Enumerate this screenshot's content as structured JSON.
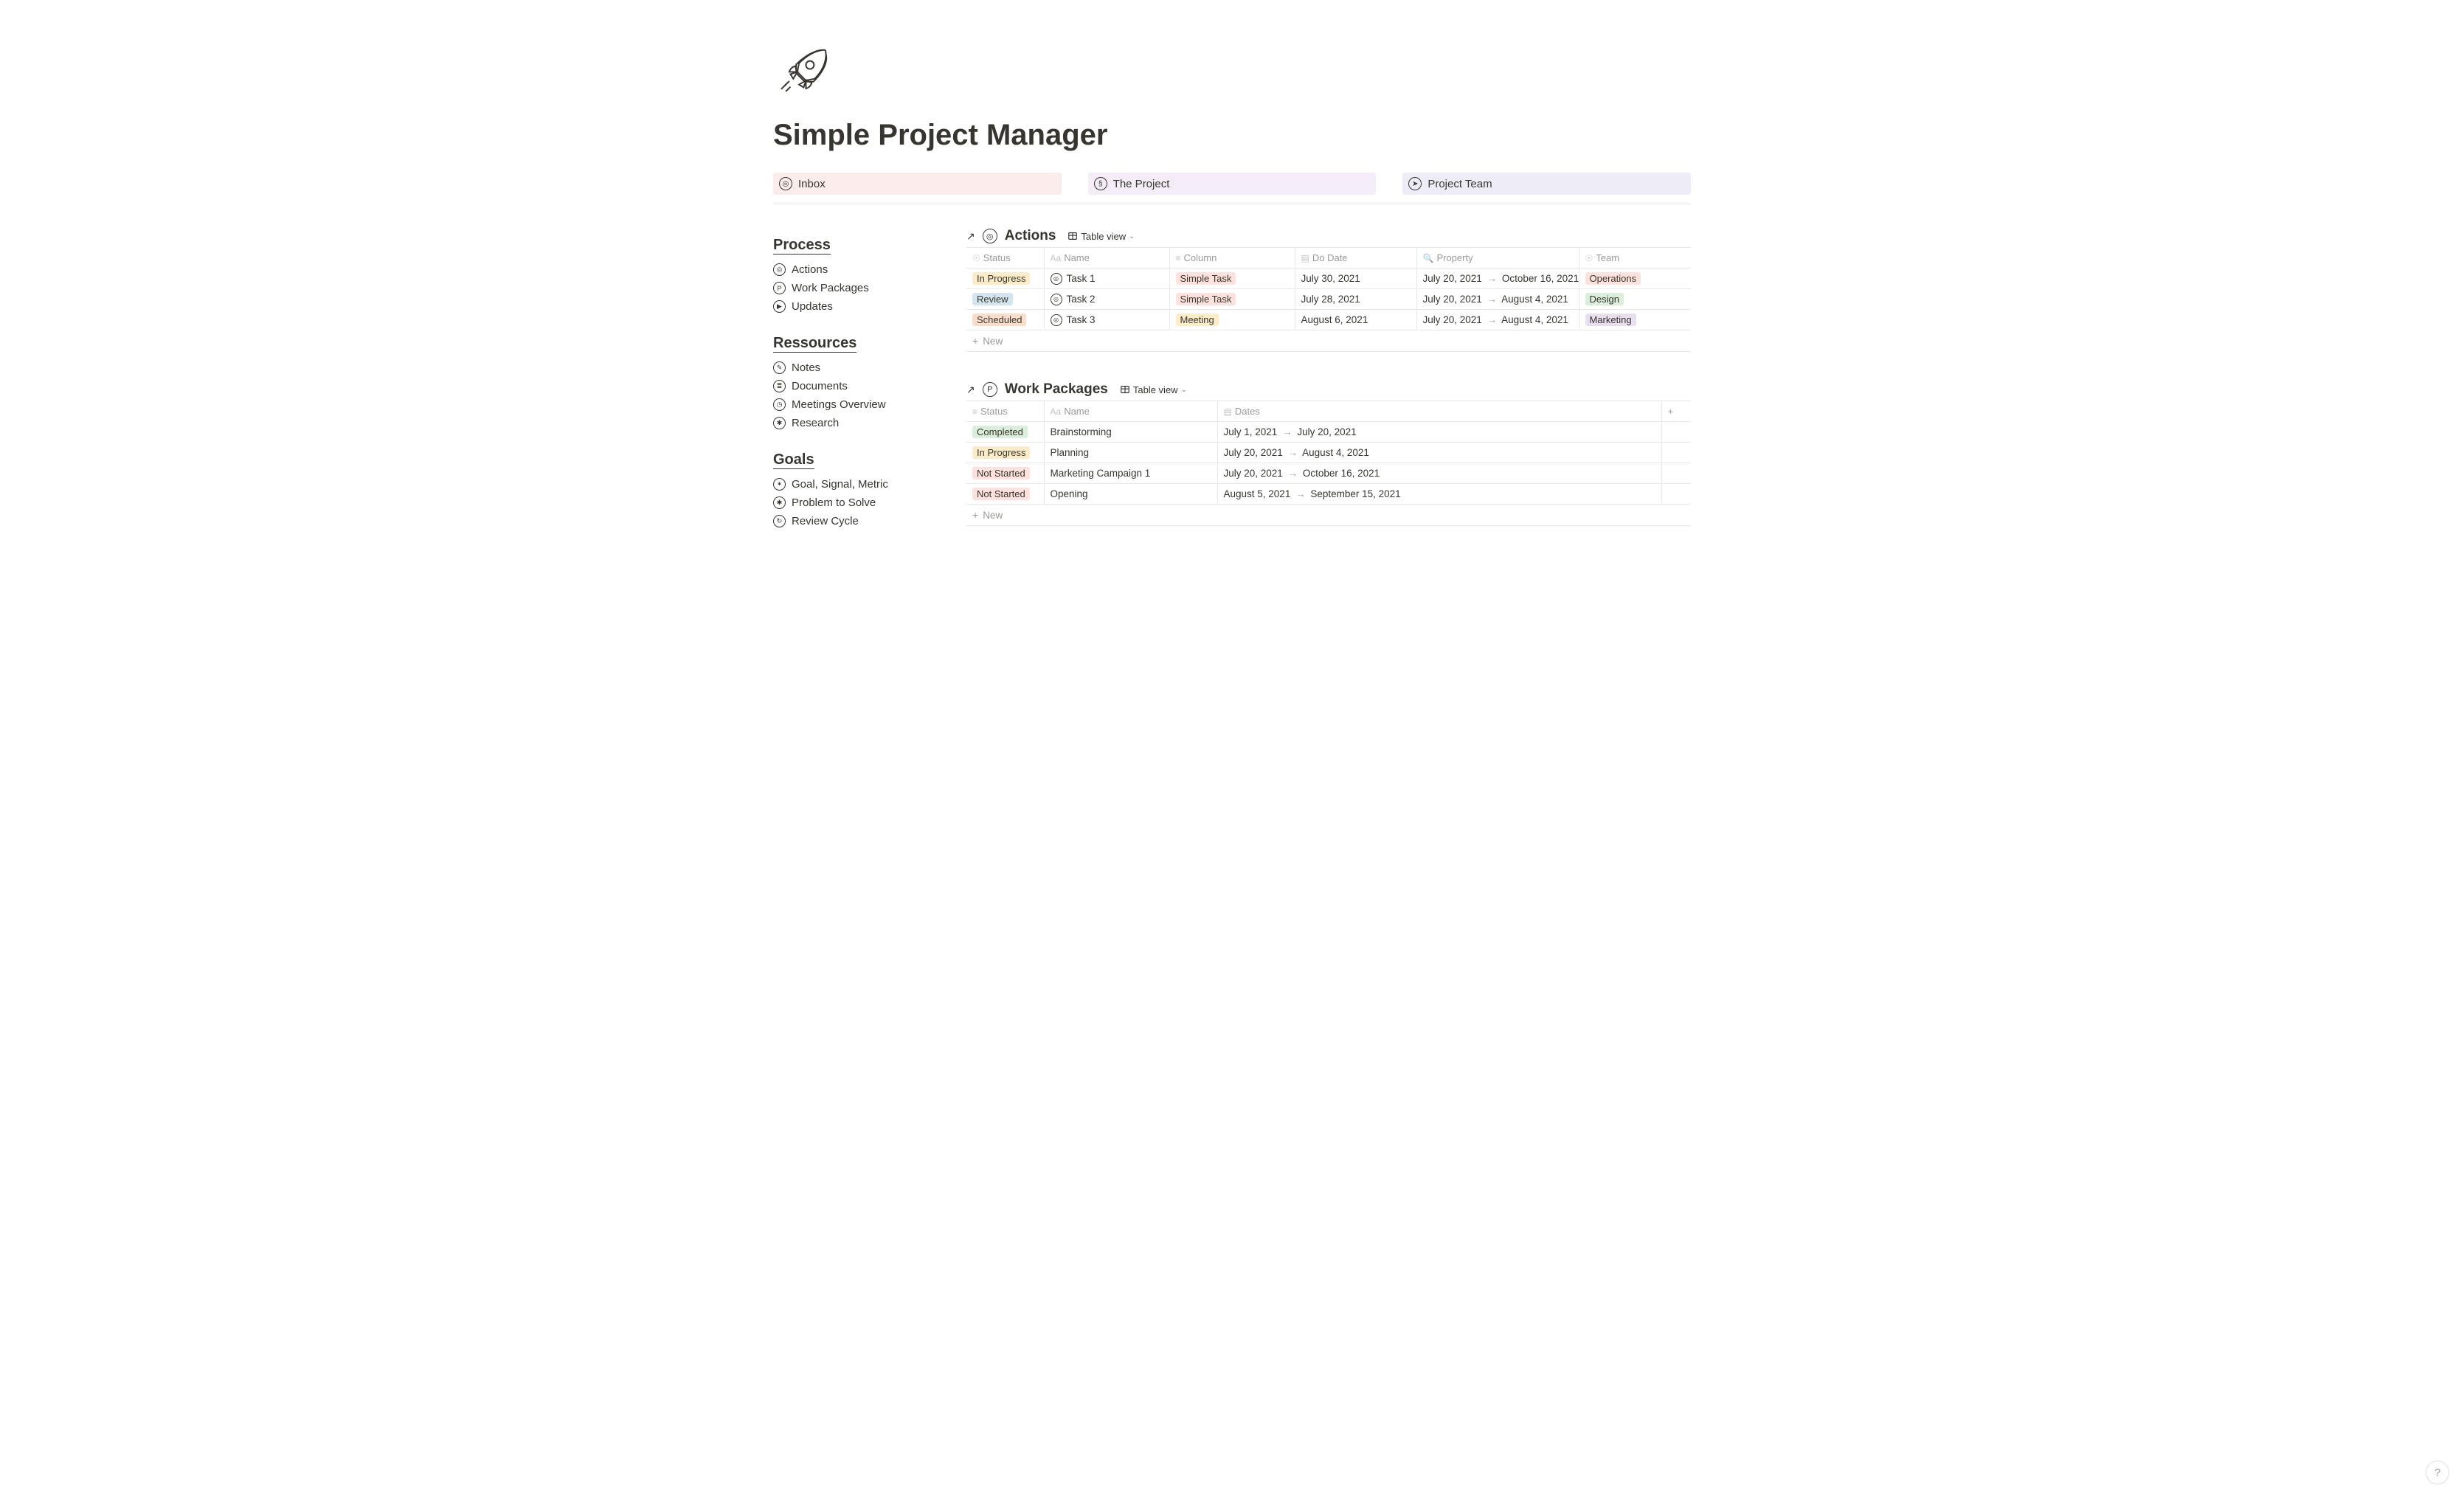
{
  "page": {
    "title": "Simple Project Manager"
  },
  "quick_links": [
    {
      "label": "Inbox"
    },
    {
      "label": "The Project"
    },
    {
      "label": "Project Team"
    }
  ],
  "sidebar": {
    "sections": [
      {
        "heading": "Process",
        "items": [
          {
            "label": "Actions"
          },
          {
            "label": "Work Packages"
          },
          {
            "label": "Updates"
          }
        ]
      },
      {
        "heading": "Ressources",
        "items": [
          {
            "label": "Notes"
          },
          {
            "label": "Documents"
          },
          {
            "label": "Meetings Overview"
          },
          {
            "label": "Research"
          }
        ]
      },
      {
        "heading": "Goals",
        "items": [
          {
            "label": "Goal, Signal, Metric"
          },
          {
            "label": "Problem to Solve"
          },
          {
            "label": "Review Cycle"
          }
        ]
      }
    ]
  },
  "db_actions": {
    "title": "Actions",
    "view_label": "Table view",
    "columns": [
      "Status",
      "Name",
      "Column",
      "Do Date",
      "Property",
      "Team"
    ],
    "rows": [
      {
        "status": "In Progress",
        "status_class": "inprogress",
        "name": "Task 1",
        "column": "Simple Task",
        "column_class": "simpletask",
        "do_date": "July 30, 2021",
        "property": "July 20, 2021 → October 16, 2021",
        "team": "Operations",
        "team_class": "operations"
      },
      {
        "status": "Review",
        "status_class": "review",
        "name": "Task 2",
        "column": "Simple Task",
        "column_class": "simpletask",
        "do_date": "July 28, 2021",
        "property": "July 20, 2021 → August 4, 2021",
        "team": "Design",
        "team_class": "design"
      },
      {
        "status": "Scheduled",
        "status_class": "scheduled",
        "name": "Task 3",
        "column": "Meeting",
        "column_class": "meeting",
        "do_date": "August 6, 2021",
        "property": "July 20, 2021 → August 4, 2021",
        "team": "Marketing",
        "team_class": "marketing"
      }
    ],
    "new_label": "New"
  },
  "db_work": {
    "title": "Work Packages",
    "view_label": "Table view",
    "columns": [
      "Status",
      "Name",
      "Dates"
    ],
    "rows": [
      {
        "status": "Completed",
        "status_class": "completed",
        "name": "Brainstorming",
        "dates": "July 1, 2021 → July 20, 2021"
      },
      {
        "status": "In Progress",
        "status_class": "inprogress",
        "name": "Planning",
        "dates": "July 20, 2021 → August 4, 2021"
      },
      {
        "status": "Not Started",
        "status_class": "notstarted",
        "name": "Marketing Campaign 1",
        "dates": "July 20, 2021 → October 16, 2021"
      },
      {
        "status": "Not Started",
        "status_class": "notstarted",
        "name": "Opening",
        "dates": "August 5, 2021 → September 15, 2021"
      }
    ],
    "new_label": "New"
  },
  "help_button": "?"
}
